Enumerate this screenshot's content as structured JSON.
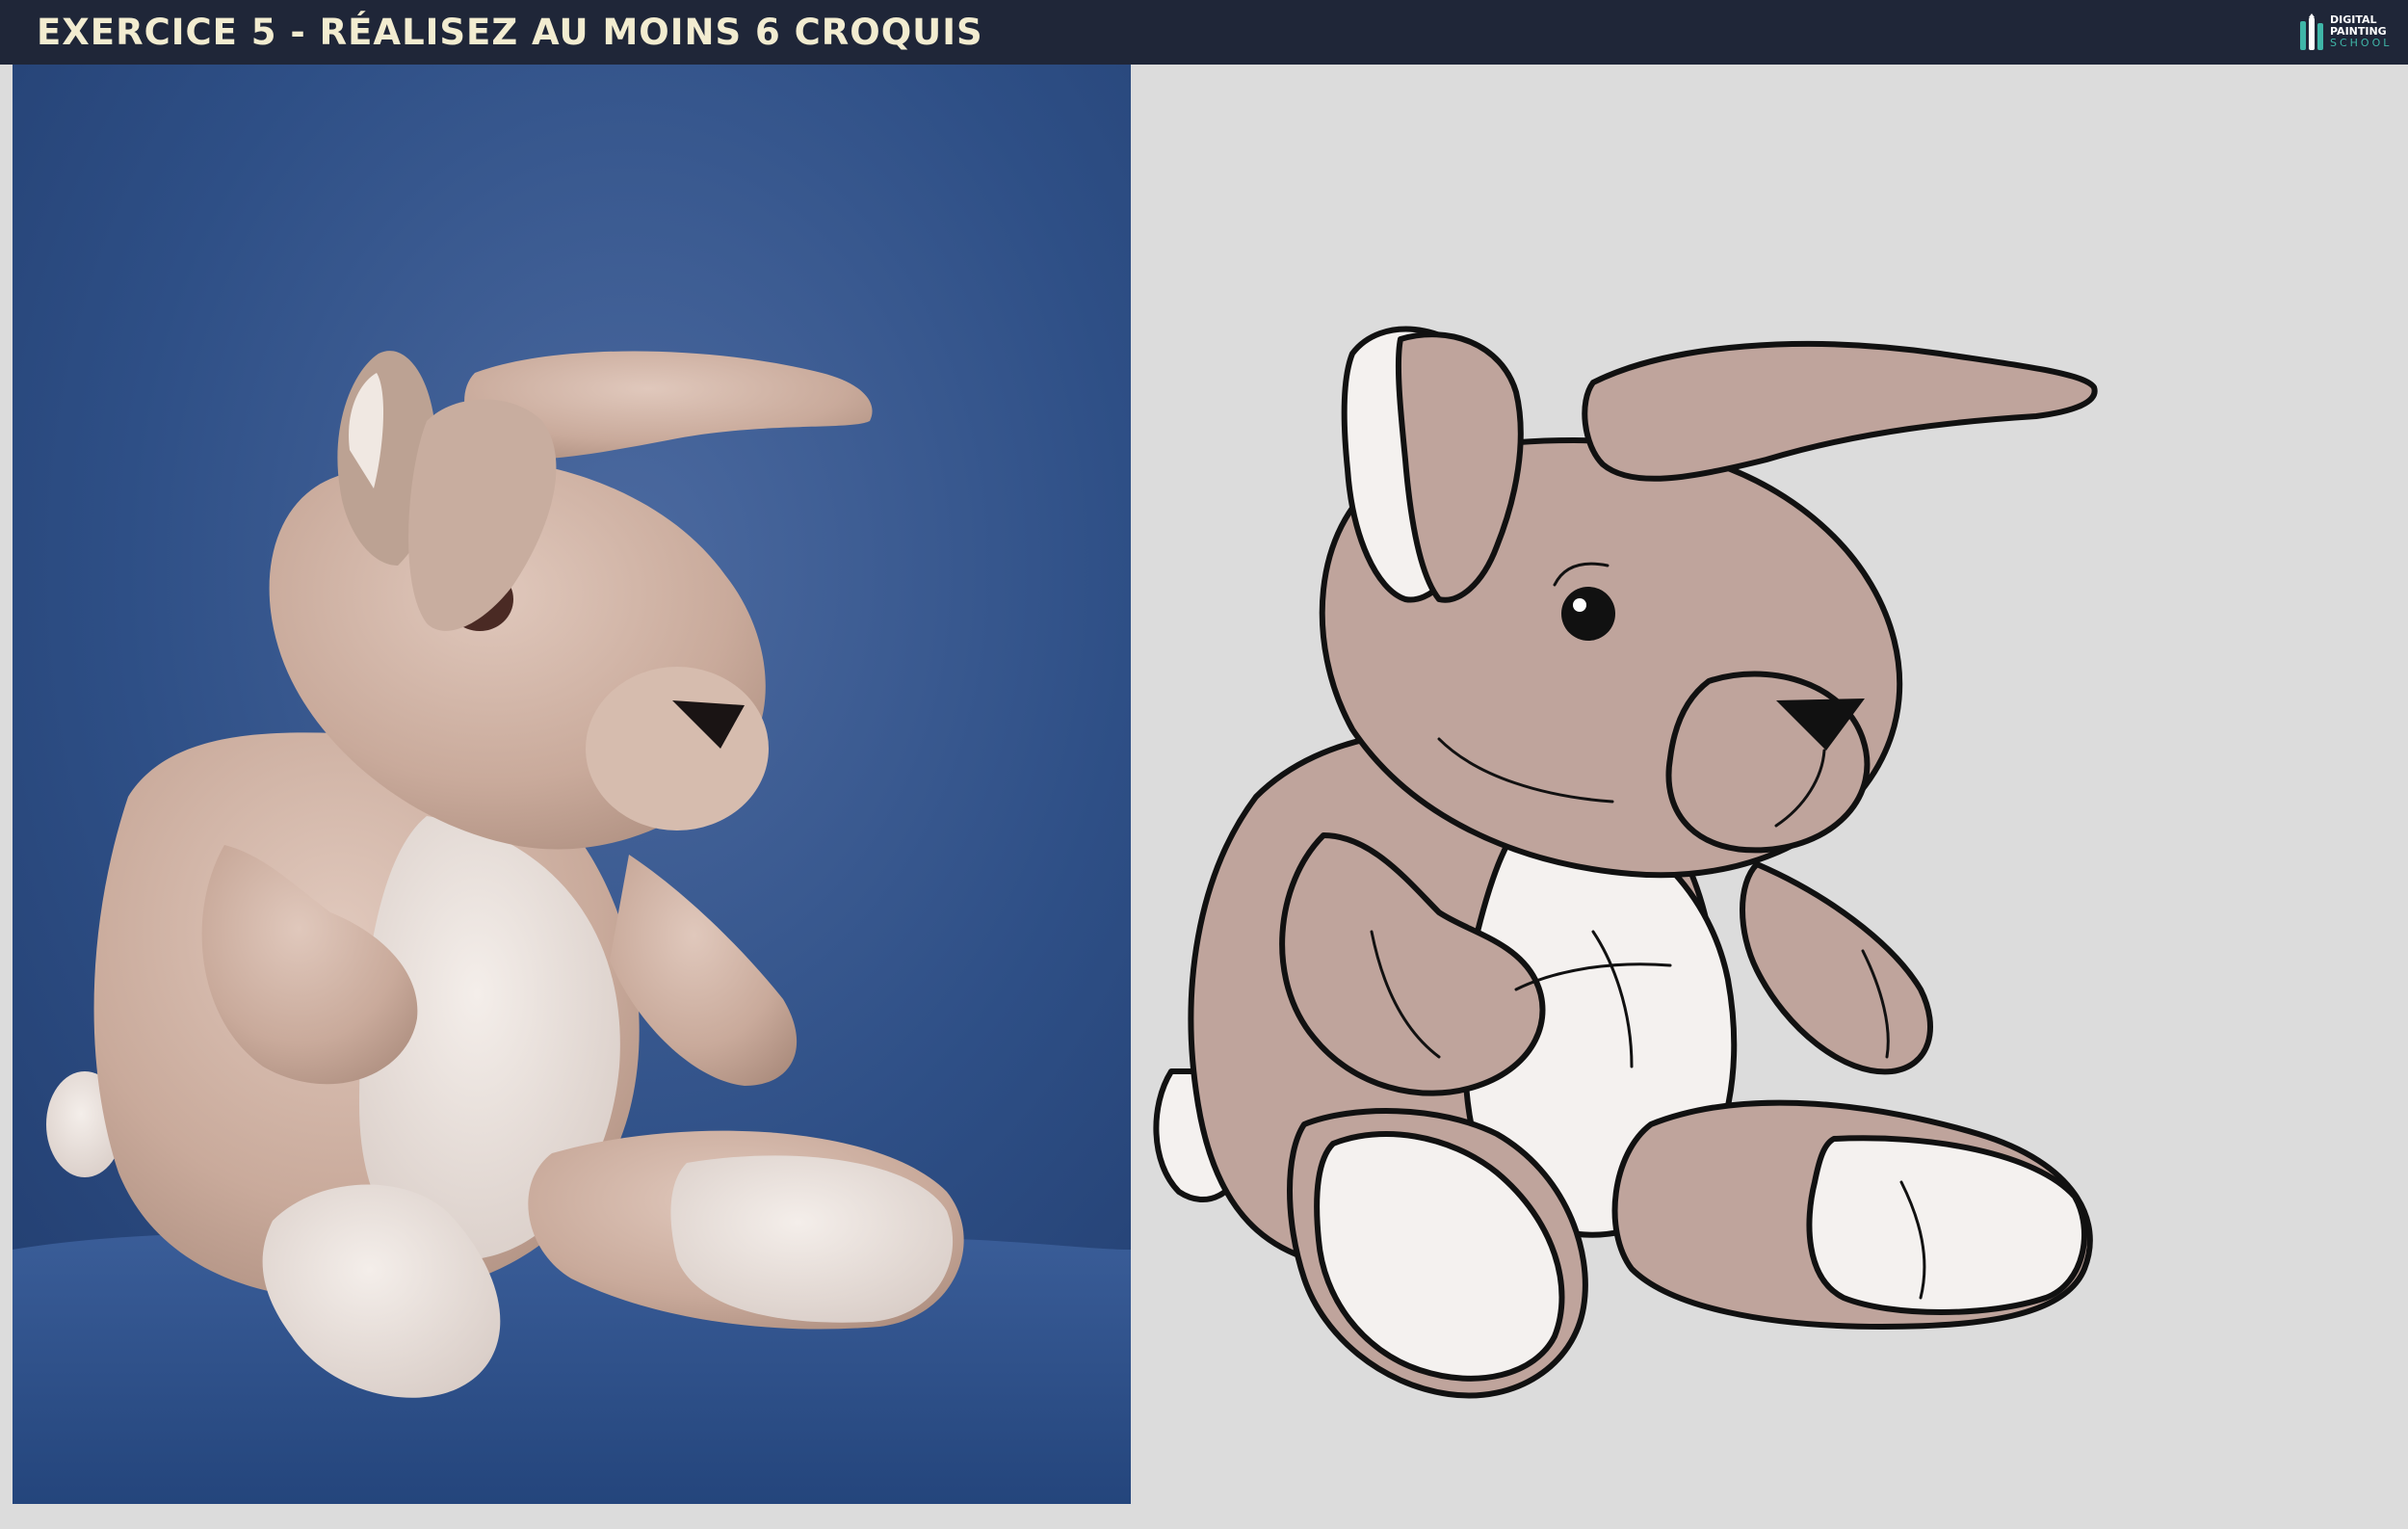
{
  "header": {
    "title": "EXERCICE 5 - RÉALISEZ AU MOINS 6 CROQUIS"
  },
  "logo": {
    "line1": "DIGITAL",
    "line2": "PAINTING",
    "line3": "SCHOOL",
    "icon": "paintbrush-logo-icon"
  },
  "photo": {
    "subject": "plush-rabbit-photo"
  },
  "sketch": {
    "subject": "plush-rabbit-line-drawing"
  },
  "colors": {
    "header_bg": "#1f2638",
    "title_text": "#f2ecd0",
    "page_bg": "#dcdcdc",
    "photo_bg": "#2e4f86",
    "plush_fill": "#bfa49c",
    "white_fill": "#f4f1ef",
    "ink": "#111111"
  }
}
